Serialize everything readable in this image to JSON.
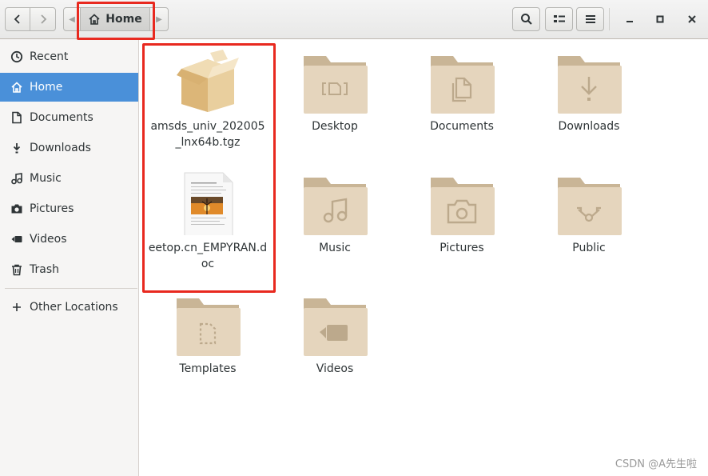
{
  "header": {
    "breadcrumb_home": "Home"
  },
  "sidebar": {
    "items": [
      {
        "label": "Recent",
        "icon": "clock-icon"
      },
      {
        "label": "Home",
        "icon": "home-icon",
        "active": true
      },
      {
        "label": "Documents",
        "icon": "document-icon"
      },
      {
        "label": "Downloads",
        "icon": "download-icon"
      },
      {
        "label": "Music",
        "icon": "music-icon"
      },
      {
        "label": "Pictures",
        "icon": "camera-icon"
      },
      {
        "label": "Videos",
        "icon": "video-icon"
      },
      {
        "label": "Trash",
        "icon": "trash-icon"
      },
      {
        "label": "Other Locations",
        "icon": "plus-icon"
      }
    ]
  },
  "files": [
    {
      "name": "amsds_univ_202005_lnx64b.tgz",
      "icon": "archive-icon"
    },
    {
      "name": "Desktop",
      "icon": "folder-desktop-icon"
    },
    {
      "name": "Documents",
      "icon": "folder-documents-icon"
    },
    {
      "name": "Downloads",
      "icon": "folder-downloads-icon"
    },
    {
      "name": "eetop.cn_EMPYRAN.doc",
      "icon": "doc-file-icon"
    },
    {
      "name": "Music",
      "icon": "folder-music-icon"
    },
    {
      "name": "Pictures",
      "icon": "folder-pictures-icon"
    },
    {
      "name": "Public",
      "icon": "folder-public-icon"
    },
    {
      "name": "Templates",
      "icon": "folder-templates-icon"
    },
    {
      "name": "Videos",
      "icon": "folder-videos-icon"
    }
  ],
  "watermark": "CSDN @A先生啦",
  "colors": {
    "accent": "#4a90d9",
    "folder": "#e5d5bd",
    "folder_tab": "#c9b596",
    "annotation": "#e8291f"
  }
}
